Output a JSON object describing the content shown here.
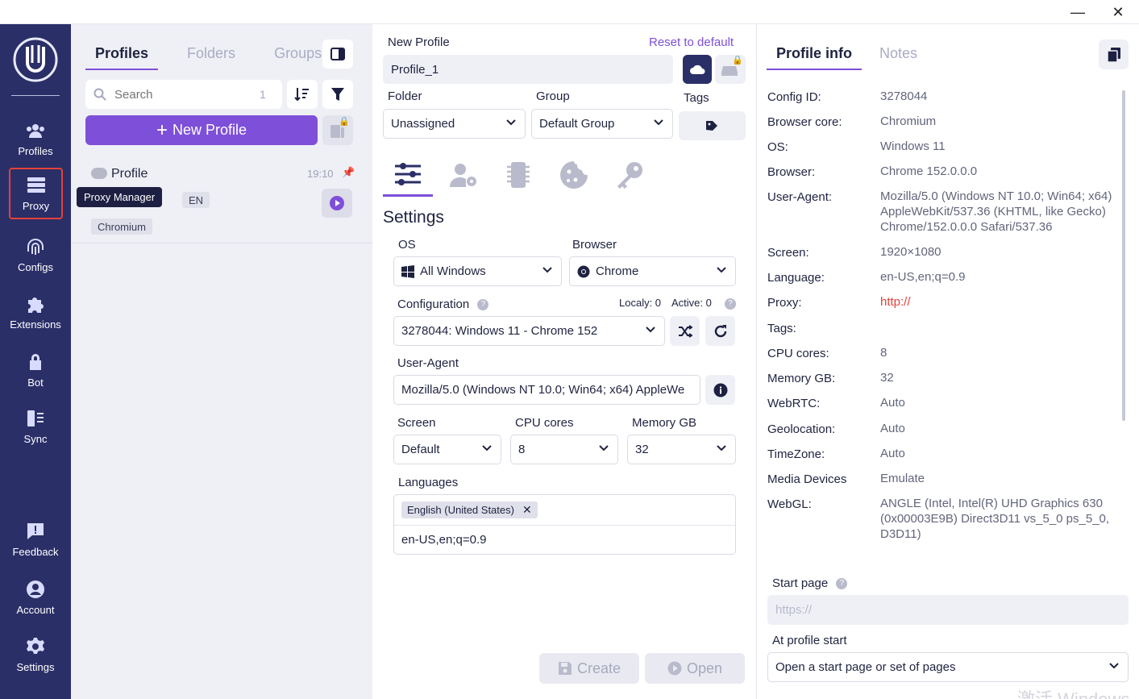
{
  "window": {
    "minimize": "—",
    "close": "✕"
  },
  "rail": {
    "items": [
      {
        "label": "Profiles",
        "icon": "users-icon"
      },
      {
        "label": "Proxy",
        "icon": "server-icon"
      },
      {
        "label": "Configs",
        "icon": "fingerprint-icon"
      },
      {
        "label": "Extensions",
        "icon": "puzzle-icon"
      },
      {
        "label": "Bot",
        "icon": "lock-icon"
      },
      {
        "label": "Sync",
        "icon": "sync-icon"
      },
      {
        "label": "Feedback",
        "icon": "feedback-icon"
      },
      {
        "label": "Account",
        "icon": "account-icon"
      },
      {
        "label": "Settings",
        "icon": "gear-icon"
      }
    ],
    "tooltip": "Proxy Manager"
  },
  "profiles_panel": {
    "tabs": [
      "Profiles",
      "Folders",
      "Groups"
    ],
    "search": {
      "placeholder": "Search",
      "count": "1"
    },
    "new_profile": "New Profile",
    "card": {
      "name": "Profile",
      "time": "19:10",
      "lang_tag": "EN",
      "core_tag": "Chromium"
    }
  },
  "form": {
    "new_profile_label": "New Profile",
    "reset": "Reset to default",
    "profile_name": "Profile_1",
    "folder_label": "Folder",
    "folder_value": "Unassigned",
    "group_label": "Group",
    "group_value": "Default Group",
    "tags_label": "Tags",
    "settings_title": "Settings",
    "os_label": "OS",
    "os_value": "All Windows",
    "browser_label": "Browser",
    "browser_value": "Chrome",
    "config_label": "Configuration",
    "locally": "Localy: 0",
    "active": "Active: 0",
    "config_value": "3278044: Windows 11 - Chrome 152",
    "ua_label": "User-Agent",
    "ua_value": "Mozilla/5.0 (Windows NT 10.0; Win64; x64) AppleWe",
    "screen_label": "Screen",
    "screen_value": "Default",
    "cpu_label": "CPU cores",
    "cpu_value": "8",
    "mem_label": "Memory GB",
    "mem_value": "32",
    "languages_label": "Languages",
    "lang_chip": "English (United States)",
    "lang_value": "en-US,en;q=0.9",
    "create": "Create",
    "open": "Open"
  },
  "info": {
    "tabs": [
      "Profile info",
      "Notes"
    ],
    "rows": [
      {
        "k": "Config ID:",
        "v": "3278044"
      },
      {
        "k": "Browser core:",
        "v": "Chromium"
      },
      {
        "k": "OS:",
        "v": "Windows 11"
      },
      {
        "k": "Browser:",
        "v": "Chrome 152.0.0.0"
      },
      {
        "k": "User-Agent:",
        "v": "Mozilla/5.0 (Windows NT 10.0; Win64; x64) AppleWebKit/537.36 (KHTML, like Gecko) Chrome/152.0.0.0 Safari/537.36"
      },
      {
        "k": "Screen:",
        "v": "1920×1080"
      },
      {
        "k": "Language:",
        "v": "en-US,en;q=0.9"
      },
      {
        "k": "Proxy:",
        "v": "http://"
      },
      {
        "k": "Tags:",
        "v": ""
      },
      {
        "k": "CPU cores:",
        "v": "8"
      },
      {
        "k": "Memory GB:",
        "v": "32"
      },
      {
        "k": "WebRTC:",
        "v": "Auto"
      },
      {
        "k": "Geolocation:",
        "v": "Auto"
      },
      {
        "k": "TimeZone:",
        "v": "Auto"
      },
      {
        "k": "Media Devices",
        "v": "Emulate"
      },
      {
        "k": "WebGL:",
        "v": "ANGLE (Intel, Intel(R) UHD Graphics 630 (0x00003E9B) Direct3D11 vs_5_0 ps_5_0, D3D11)"
      }
    ],
    "start_page_label": "Start page",
    "start_page_placeholder": "https://",
    "at_start_label": "At profile start",
    "at_start_value": "Open a start page or set of pages"
  },
  "watermark": "激活 Windows",
  "colors": {
    "rail": "#2b2f67",
    "accent": "#7e4fd9",
    "highlight": "#e5413a"
  }
}
